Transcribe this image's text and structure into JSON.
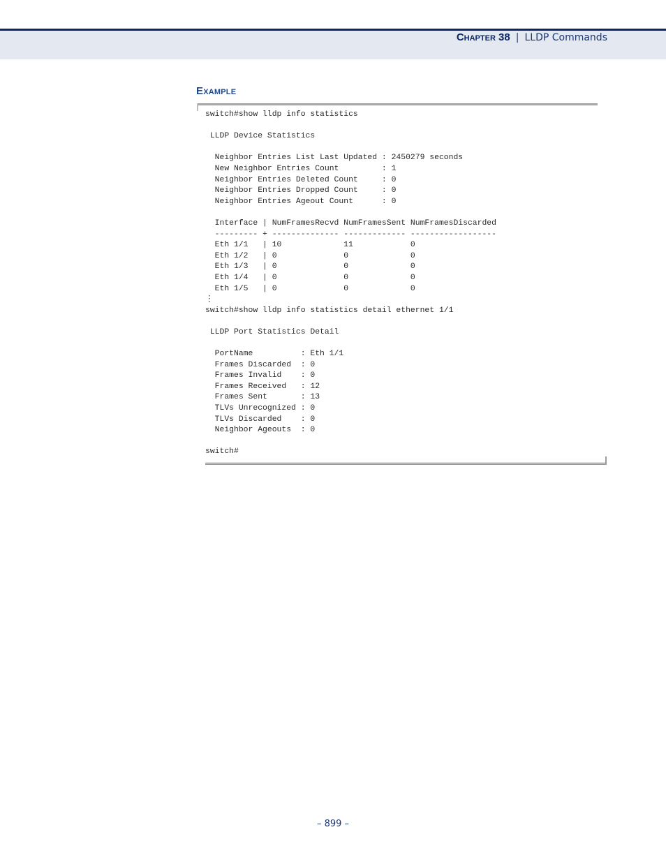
{
  "header": {
    "chapter_label": "Chapter 38",
    "separator": "|",
    "chapter_title": "LLDP Commands"
  },
  "section": {
    "heading": "Example"
  },
  "code_example": {
    "lines": [
      "switch#show lldp info statistics",
      "",
      " LLDP Device Statistics",
      "",
      "  Neighbor Entries List Last Updated : 2450279 seconds",
      "  New Neighbor Entries Count         : 1",
      "  Neighbor Entries Deleted Count     : 0",
      "  Neighbor Entries Dropped Count     : 0",
      "  Neighbor Entries Ageout Count      : 0",
      "",
      "  Interface | NumFramesRecvd NumFramesSent NumFramesDiscarded",
      "  --------- + -------------- ------------- ------------------",
      "  Eth 1/1   | 10             11            0",
      "  Eth 1/2   | 0              0             0",
      "  Eth 1/3   | 0              0             0",
      "  Eth 1/4   | 0              0             0",
      "  Eth 1/5   | 0              0             0",
      "⋮",
      "switch#show lldp info statistics detail ethernet 1/1",
      "",
      " LLDP Port Statistics Detail",
      "",
      "  PortName          : Eth 1/1",
      "  Frames Discarded  : 0",
      "  Frames Invalid    : 0",
      "  Frames Received   : 12",
      "  Frames Sent       : 13",
      "  TLVs Unrecognized : 0",
      "  TLVs Discarded    : 0",
      "  Neighbor Ageouts  : 0",
      "",
      "switch#"
    ]
  },
  "footer": {
    "page_number": "–  899  –"
  }
}
